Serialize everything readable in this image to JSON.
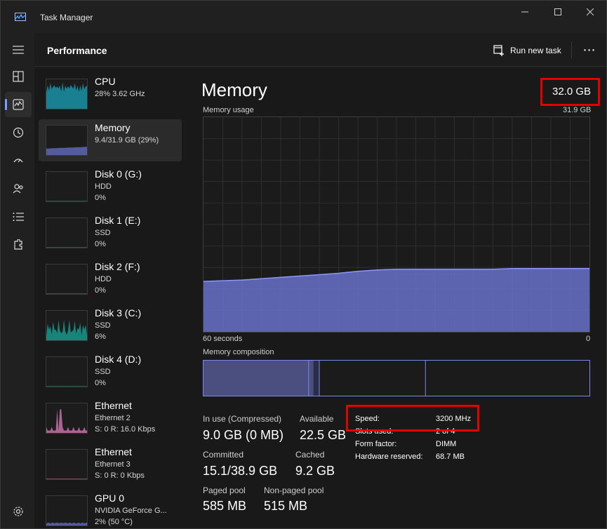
{
  "window": {
    "title": "Task Manager",
    "colors": {
      "accent": "#7f9cff",
      "memory_fill": "#6871c9",
      "memory_line": "#8c96ff",
      "highlight": "#e50000"
    }
  },
  "rail": {
    "items": [
      {
        "icon": "hamburger-menu-icon"
      },
      {
        "icon": "processes-icon"
      },
      {
        "icon": "performance-icon",
        "active": true
      },
      {
        "icon": "app-history-icon"
      },
      {
        "icon": "startup-apps-icon"
      },
      {
        "icon": "users-icon"
      },
      {
        "icon": "details-icon"
      },
      {
        "icon": "services-icon"
      }
    ],
    "settings_icon": "gear-icon"
  },
  "header": {
    "title": "Performance",
    "run_new_task": "Run new task",
    "more": "⋯"
  },
  "devices": [
    {
      "name": "CPU",
      "line1": "28%  3.62 GHz",
      "line2": "",
      "color": "#17a2b8",
      "kind": "spiky-high"
    },
    {
      "name": "Memory",
      "line1": "9.4/31.9 GB (29%)",
      "line2": "",
      "color": "#6871c9",
      "kind": "flat",
      "selected": true
    },
    {
      "name": "Disk 0 (G:)",
      "line1": "HDD",
      "line2": "0%",
      "color": "#2e9e8f",
      "kind": "empty"
    },
    {
      "name": "Disk 1 (E:)",
      "line1": "SSD",
      "line2": "0%",
      "color": "#2e9e8f",
      "kind": "empty"
    },
    {
      "name": "Disk 2 (F:)",
      "line1": "HDD",
      "line2": "0%",
      "color": "#2e9e8f",
      "kind": "empty"
    },
    {
      "name": "Disk 3 (C:)",
      "line1": "SSD",
      "line2": "6%",
      "color": "#17a89a",
      "kind": "spiky-mid"
    },
    {
      "name": "Disk 4 (D:)",
      "line1": "SSD",
      "line2": "0%",
      "color": "#2e9e8f",
      "kind": "empty"
    },
    {
      "name": "Ethernet",
      "line1": "Ethernet 2",
      "line2": "S: 0  R: 16.0 Kbps",
      "color": "#d97bbb",
      "kind": "spiky-pink"
    },
    {
      "name": "Ethernet",
      "line1": "Ethernet 3",
      "line2": "S: 0  R: 0 Kbps",
      "color": "#d97bbb",
      "kind": "empty"
    },
    {
      "name": "GPU 0",
      "line1": "NVIDIA GeForce G...",
      "line2": "2%  (50 °C)",
      "color": "#6871c9",
      "kind": "low"
    }
  ],
  "memory": {
    "title": "Memory",
    "total": "32.0 GB",
    "usage_label": "Memory usage",
    "usage_max": "31.9 GB",
    "x_left_label": "60 seconds",
    "x_right_label": "0",
    "composition_label": "Memory composition",
    "chart_data": {
      "type": "area",
      "title": "Memory usage",
      "ylim": [
        0,
        31.9
      ],
      "xlim": [
        60,
        0
      ],
      "x": [
        60,
        57,
        54,
        51,
        48,
        45,
        42,
        39,
        36,
        33,
        30,
        27,
        24,
        21,
        18,
        15,
        12,
        9,
        6,
        3,
        0
      ],
      "values": [
        7.5,
        7.6,
        7.7,
        7.9,
        8.1,
        8.3,
        8.5,
        8.7,
        9.0,
        9.2,
        9.3,
        9.3,
        9.3,
        9.3,
        9.3,
        9.3,
        9.4,
        9.4,
        9.4,
        9.4,
        9.4
      ]
    },
    "composition": {
      "in_use_fraction": 0.285,
      "modified_fraction": 0.015,
      "standby_fraction": 0.275
    },
    "stats": {
      "in_use_label": "In use (Compressed)",
      "in_use_value": "9.0 GB (0 MB)",
      "available_label": "Available",
      "available_value": "22.5 GB",
      "committed_label": "Committed",
      "committed_value": "15.1/38.9 GB",
      "cached_label": "Cached",
      "cached_value": "9.2 GB",
      "paged_label": "Paged pool",
      "paged_value": "585 MB",
      "nonpaged_label": "Non-paged pool",
      "nonpaged_value": "515 MB"
    },
    "details": [
      {
        "key": "Speed:",
        "value": "3200 MHz"
      },
      {
        "key": "Slots used:",
        "value": "2 of 4"
      },
      {
        "key": "Form factor:",
        "value": "DIMM"
      },
      {
        "key": "Hardware reserved:",
        "value": "68.7 MB"
      }
    ]
  }
}
